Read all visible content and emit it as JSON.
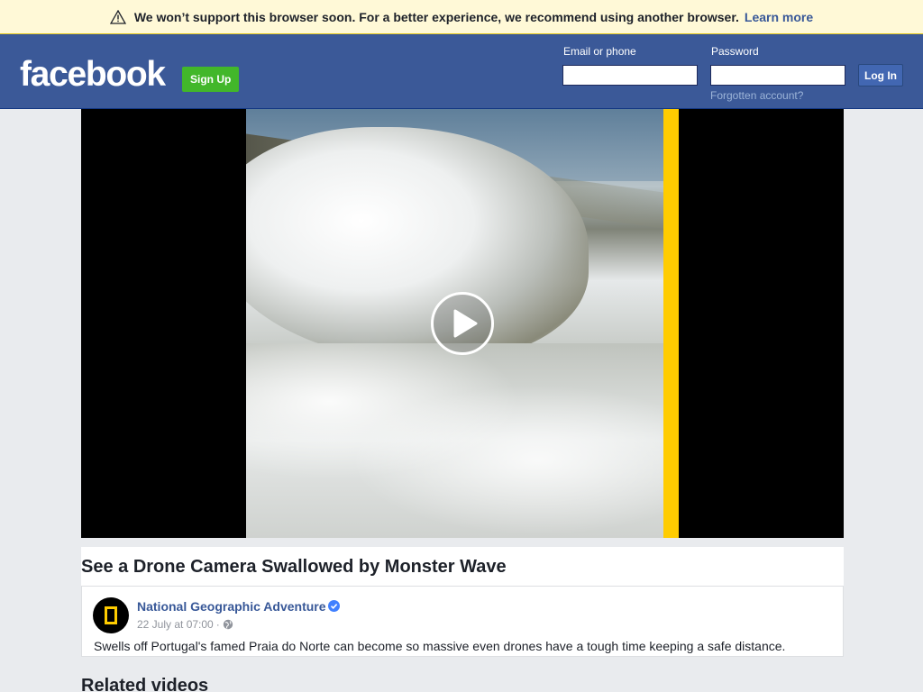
{
  "banner": {
    "text": "We won’t support this browser soon. For a better experience, we recommend using another browser.",
    "learn_more": "Learn more",
    "icon": "warning-triangle-icon"
  },
  "header": {
    "logo": "facebook",
    "signup_label": "Sign Up",
    "email_label": "Email or phone",
    "password_label": "Password",
    "email_value": "",
    "password_value": "",
    "login_label": "Log In",
    "forgot_label": "Forgotten account?",
    "brand_color": "#3b5998",
    "signup_color": "#42b72a"
  },
  "video": {
    "play_icon": "play-icon",
    "accent_color": "#ffcc00"
  },
  "post": {
    "title": "See a Drone Camera Swallowed by Monster Wave",
    "page_name": "National Geographic Adventure",
    "verified_icon": "verified-badge-icon",
    "date": "22 July at 07:00",
    "separator": "·",
    "audience_icon": "globe-icon",
    "description": "Swells off Portugal's famed Praia do Norte can become so massive even drones have a tough time keeping a safe distance."
  },
  "related": {
    "heading": "Related videos"
  }
}
